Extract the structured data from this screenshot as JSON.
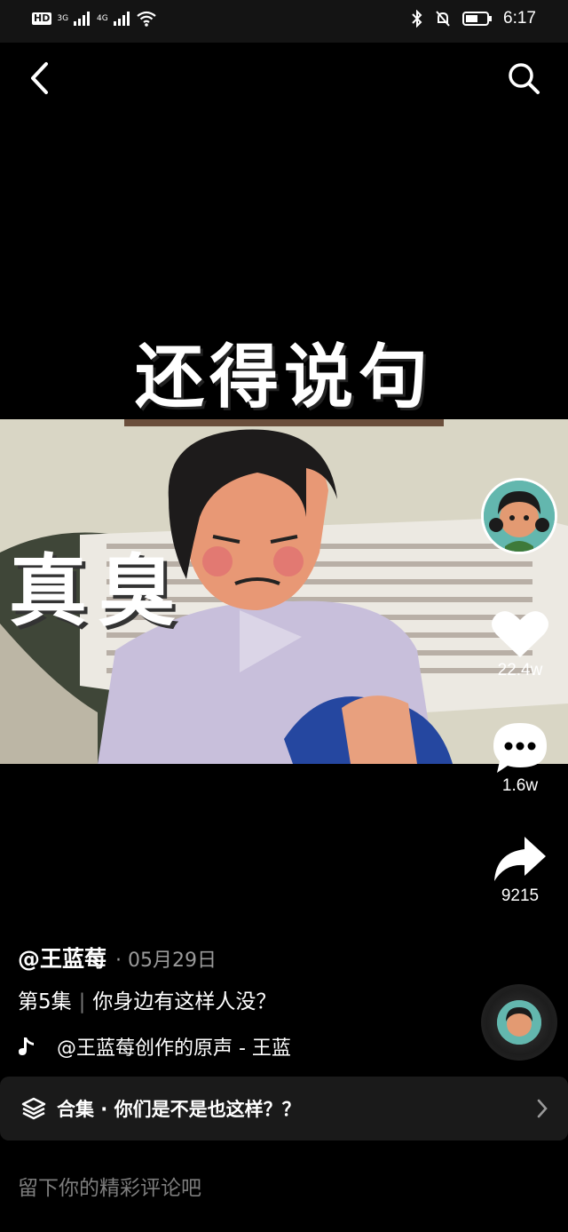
{
  "status_bar": {
    "hd_label": "HD",
    "network_1": "3G",
    "network_2": "4G",
    "time": "6:17"
  },
  "nav": {
    "back_icon": "chevron-left-icon",
    "search_icon": "search-icon"
  },
  "video": {
    "caption_top": "还得说句",
    "caption_side": "真臭"
  },
  "actions": {
    "like_count": "22.4w",
    "comment_count": "1.6w",
    "share_count": "9215"
  },
  "post": {
    "author": "@王蓝莓",
    "date": "· 05月29日",
    "episode": "第5集",
    "description": "你身边有这样人没？",
    "music": "@王蓝莓创作的原声 - 王蓝"
  },
  "collection": {
    "label": "合集 · 你们是不是也这样？？"
  },
  "comment": {
    "placeholder": "留下你的精彩评论吧"
  },
  "colors": {
    "background": "#000000",
    "panel": "#1a1a1a",
    "muted_text": "#9a9a9a"
  }
}
